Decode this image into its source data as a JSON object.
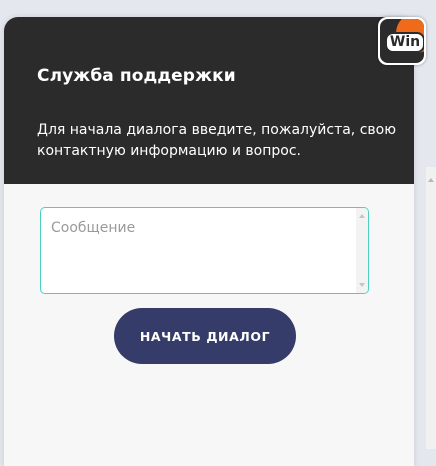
{
  "header": {
    "title": "Служба поддержки",
    "description": "Для начала диалога введите, пожалуйста, свою контактную информацию и вопрос."
  },
  "message": {
    "placeholder": "Сообщение",
    "value": ""
  },
  "actions": {
    "start_label": "НАЧАТЬ ДИАЛОГ"
  },
  "logo": {
    "text": "Win",
    "brand_color": "#f06a1c"
  },
  "colors": {
    "header_bg": "#2b2b2b",
    "button_bg": "#363c69",
    "input_border": "#4ccfc1"
  }
}
